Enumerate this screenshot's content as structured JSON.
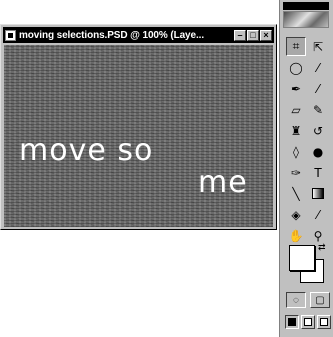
{
  "document": {
    "title": "moving selections.PSD @ 100% (Laye...",
    "canvas_words": [
      "move so",
      "me"
    ],
    "controls": {
      "minimize": "–",
      "maximize": "□",
      "close": "×"
    }
  },
  "toolbox": {
    "tools": [
      [
        "crop-icon",
        "move-icon"
      ],
      [
        "lasso-icon",
        "magic-wand-icon"
      ],
      [
        "airbrush-icon",
        "paintbrush-icon"
      ],
      [
        "eraser-icon",
        "pencil-icon"
      ],
      [
        "rubber-stamp-icon",
        "history-brush-icon"
      ],
      [
        "blur-icon",
        "burn-icon"
      ],
      [
        "pen-icon",
        "type-icon"
      ],
      [
        "line-icon",
        "gradient-icon"
      ],
      [
        "paint-bucket-icon",
        "eyedropper-icon"
      ],
      [
        "hand-icon",
        "zoom-icon"
      ]
    ],
    "glyphs": {
      "crop-icon": "⌗",
      "move-icon": "⇱",
      "lasso-icon": "◯",
      "magic-wand-icon": "⁄",
      "airbrush-icon": "✒",
      "paintbrush-icon": "⁄",
      "eraser-icon": "▱",
      "pencil-icon": "✎",
      "rubber-stamp-icon": "♜",
      "history-brush-icon": "↺",
      "blur-icon": "◊",
      "burn-icon": "●",
      "pen-icon": "✑",
      "type-icon": "T",
      "line-icon": "╲",
      "gradient-icon": "",
      "paint-bucket-icon": "◈",
      "eyedropper-icon": "⁄",
      "hand-icon": "✋",
      "zoom-icon": "⚲"
    },
    "pressed_tool": "crop-icon",
    "foreground_color": "#ffffff",
    "background_color": "#ffffff",
    "swap_glyph": "⇄",
    "mode_glyphs": [
      "◌",
      "▢"
    ],
    "screen_modes": 3
  }
}
